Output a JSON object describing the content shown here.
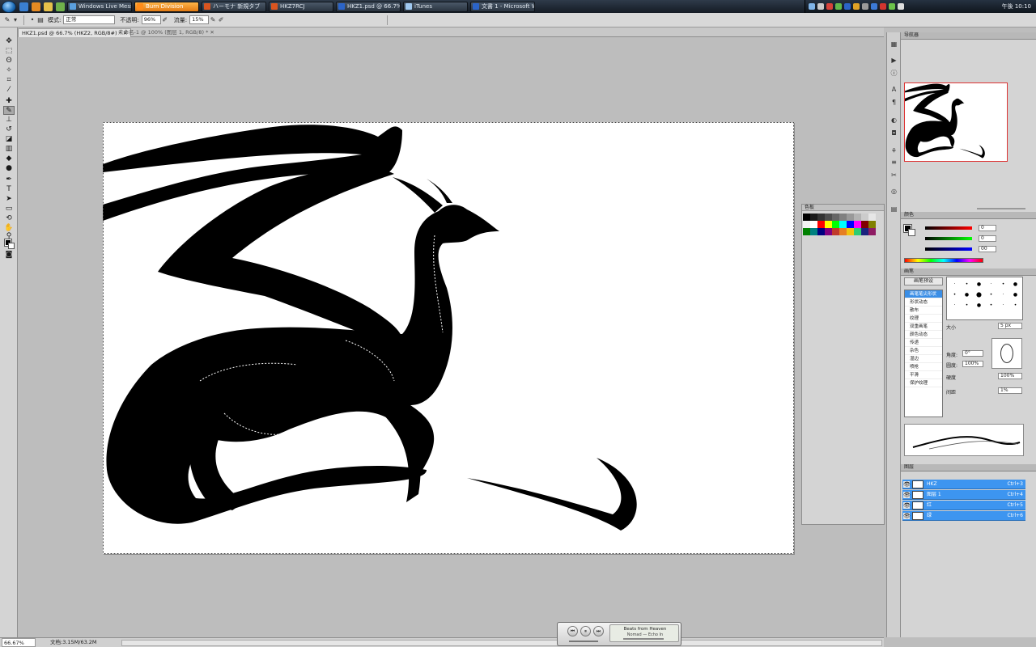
{
  "taskbar": {
    "buttons": [
      {
        "label": "Windows Live Mess...",
        "color": "#5aa0e0"
      },
      {
        "label": "Burn Division",
        "color": "#ff8c1a",
        "active": true
      },
      {
        "label": "ハーモナ 新規タブ",
        "color": "#d9541f"
      },
      {
        "label": "HKZ7RCJ",
        "color": "#d9541f"
      },
      {
        "label": "HKZ1.psd @ 66.7%...",
        "color": "#2b64c8"
      },
      {
        "label": "iTunes",
        "color": "#9fc8f0"
      },
      {
        "label": "文書 1 - Microsoft W...",
        "color": "#2b64c8"
      }
    ],
    "clock": "午後 10:10"
  },
  "options_bar": {
    "mode_label": "模式:",
    "mode_value": "正常",
    "opacity_label": "不透明:",
    "opacity_value": "96%",
    "flow_label": "流量:",
    "flow_value": "15%"
  },
  "document": {
    "tab_title": "HKZ1.psd @ 66.7% (HKZ2, RGB/8#) *",
    "tab2_title": "未命名-1 @ 100% (图层 1, RGB/8) *"
  },
  "status": {
    "zoom": "66.67%",
    "doc_size": "文档:3.15M/63.2M"
  },
  "panels": {
    "swatches_title": "色板",
    "navigator_title": "导航器",
    "color_title": "颜色",
    "color_values": {
      "r": "0",
      "g": "0",
      "b": "00"
    },
    "brushes_tab": "画笔",
    "brush_preset_button": "画笔预设",
    "brush_list": [
      "画笔笔尖形状",
      "形状动态",
      "散布",
      "纹理",
      "双重画笔",
      "颜色动态",
      "传递",
      "杂色",
      "湿边",
      "喷枪",
      "平滑",
      "保护纹理"
    ],
    "brush_size_label": "大小",
    "brush_size_value": "5 px",
    "brush_angle_label": "角度:",
    "brush_angle_value": "0°",
    "brush_round_label": "圆度:",
    "brush_round_value": "100%",
    "brush_hard_label": "硬度",
    "brush_hard_value": "100%",
    "brush_spacing_label": "间距",
    "brush_spacing_value": "1%",
    "layers_tab": "图层",
    "layers": [
      {
        "name": "HKZ",
        "shortcut": "Ctrl+3"
      },
      {
        "name": "图层 1",
        "shortcut": "Ctrl+4"
      },
      {
        "name": "红",
        "shortcut": "Ctrl+5"
      },
      {
        "name": "绿",
        "shortcut": "Ctrl+6"
      }
    ]
  },
  "player": {
    "track": "Beats from Heaven",
    "artist": "Nomad — Echo In"
  }
}
